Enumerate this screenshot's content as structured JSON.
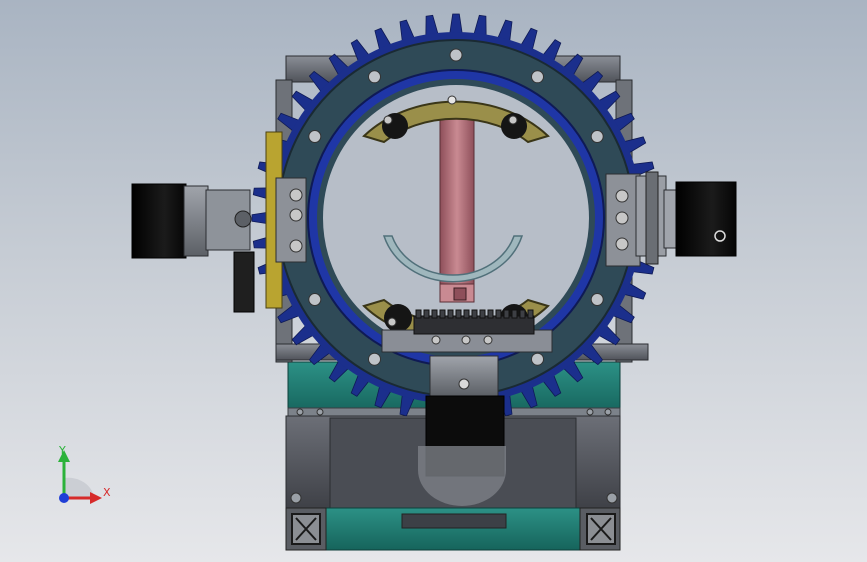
{
  "viewport": {
    "background_top": "#a9b4c2",
    "background_bottom": "#e6e7ea"
  },
  "triad": {
    "y_label": "Y",
    "x_label": "X",
    "z_label": "",
    "y_color": "#2bb23a",
    "x_color": "#d62a2a",
    "z_color": "#1f3ed6"
  },
  "model": {
    "ring_gear_color": "#1b2f8c",
    "ring_plate_color": "#2f4a57",
    "base_color": "#1f7c73",
    "frame_color": "#6b6f78",
    "shaft_color": "#b86b77",
    "segment_color": "#9a8f4a",
    "arc_guide_color": "#9fb7bd",
    "motor_color": "#0c0c0c",
    "side_gear_color": "#b9a430"
  }
}
